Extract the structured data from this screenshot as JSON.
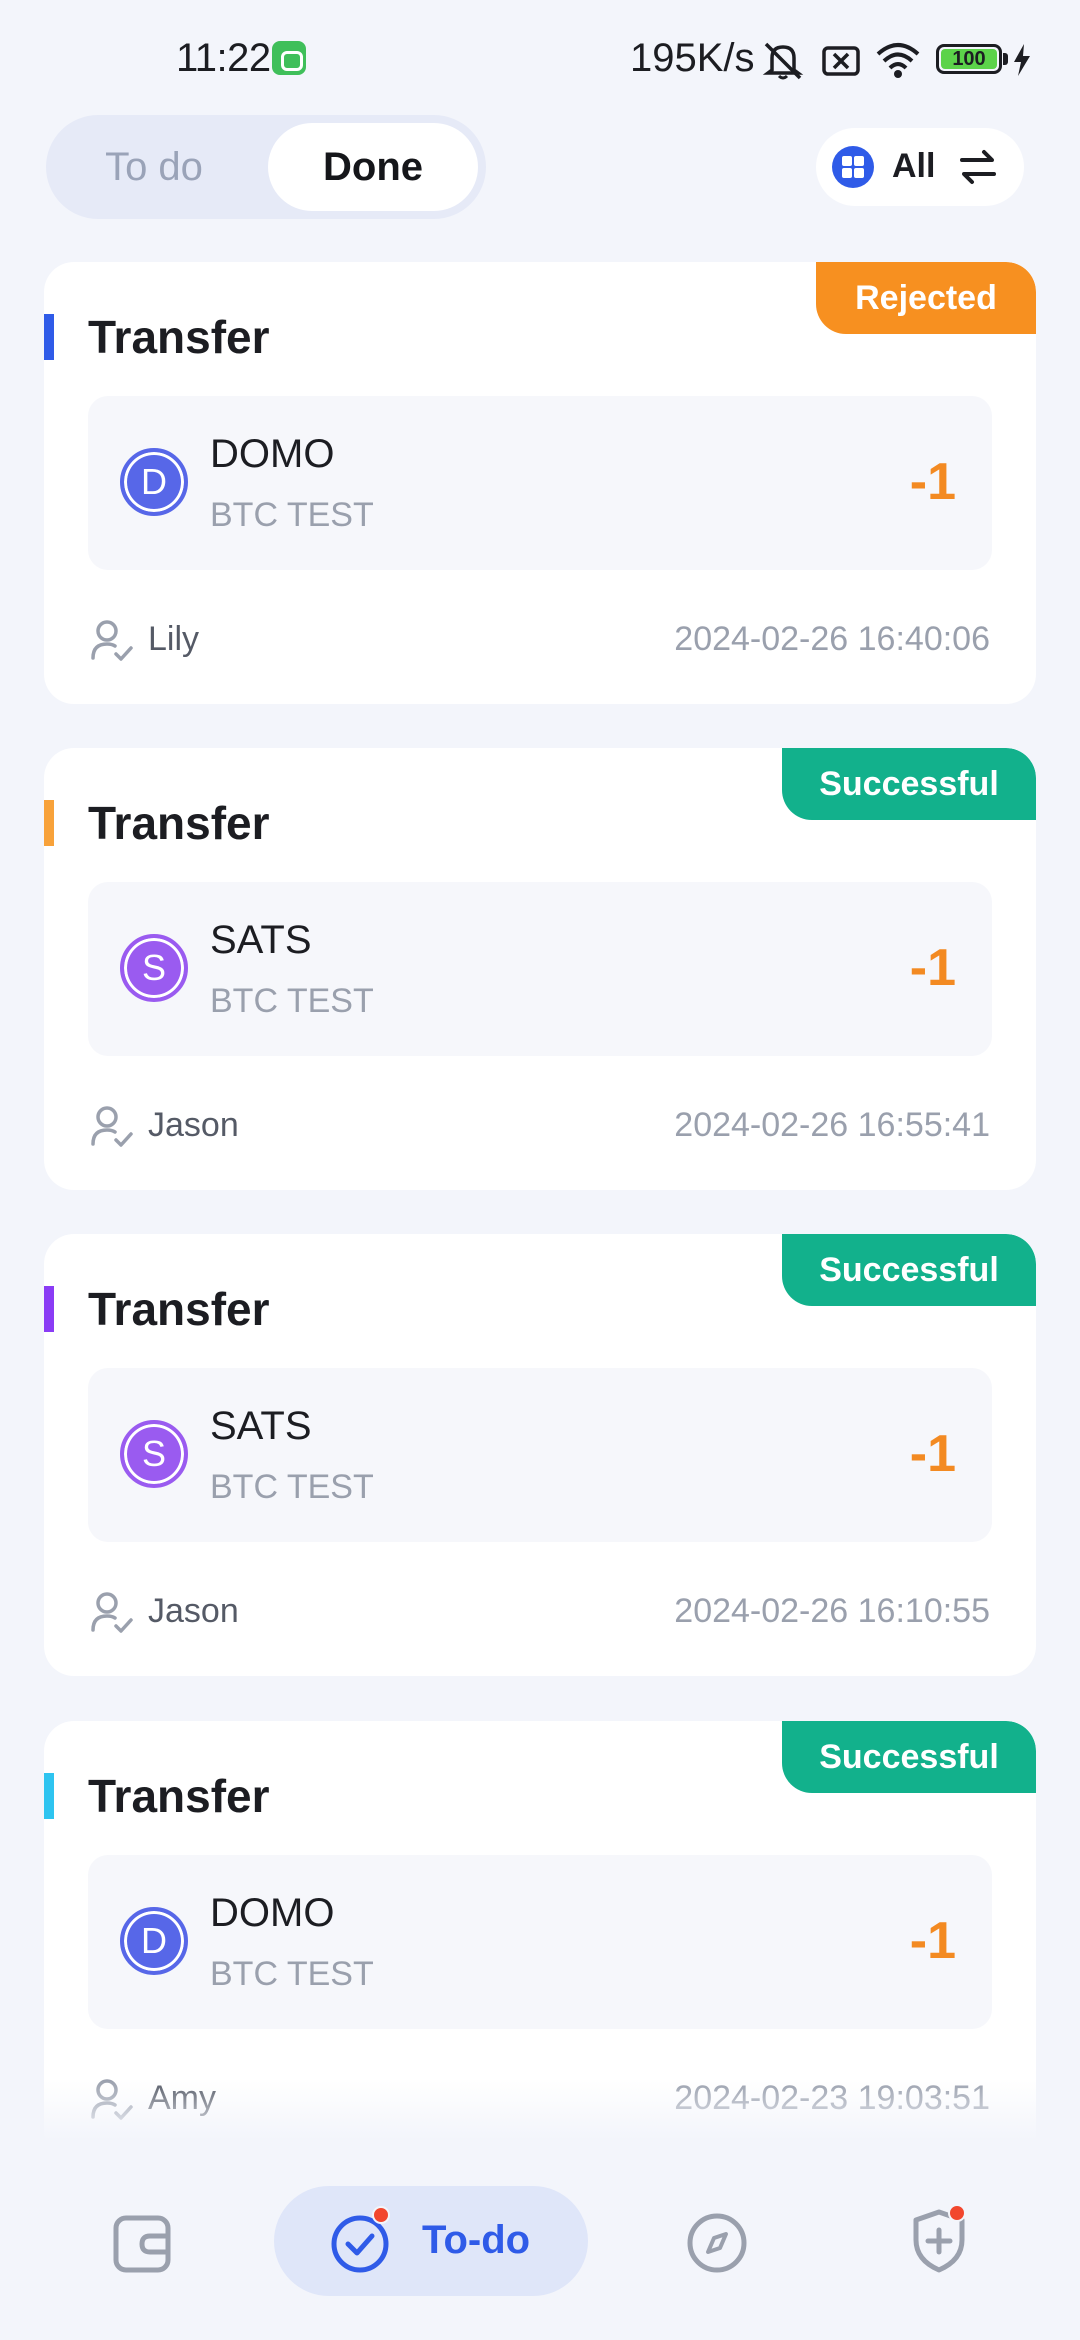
{
  "status_bar": {
    "time": "11:22",
    "network_speed": "195K/s",
    "battery": "100"
  },
  "header": {
    "tabs": [
      {
        "label": "To do",
        "active": false
      },
      {
        "label": "Done",
        "active": true
      }
    ],
    "filter": {
      "label": "All",
      "icon": "grid-icon",
      "swap_icon": "swap-icon"
    }
  },
  "cards": [
    {
      "title": "Transfer",
      "accent_color": "#2f5be8",
      "status": "Rejected",
      "status_color": "#f79020",
      "asset": {
        "initial": "D",
        "name": "DOMO",
        "sub": "BTC TEST",
        "avatar_color": "#5767e8"
      },
      "amount": "-1",
      "user": "Lily",
      "time": "2024-02-26 16:40:06"
    },
    {
      "title": "Transfer",
      "accent_color": "#f8a23a",
      "status": "Successful",
      "status_color": "#12b18c",
      "asset": {
        "initial": "S",
        "name": "SATS",
        "sub": "BTC TEST",
        "avatar_color": "#9a5bf0"
      },
      "amount": "-1",
      "user": "Jason",
      "time": "2024-02-26 16:55:41"
    },
    {
      "title": "Transfer",
      "accent_color": "#8a3cf5",
      "status": "Successful",
      "status_color": "#12b18c",
      "asset": {
        "initial": "S",
        "name": "SATS",
        "sub": "BTC TEST",
        "avatar_color": "#9a5bf0"
      },
      "amount": "-1",
      "user": "Jason",
      "time": "2024-02-26 16:10:55"
    },
    {
      "title": "Transfer",
      "accent_color": "#2ec4f0",
      "status": "Successful",
      "status_color": "#12b18c",
      "asset": {
        "initial": "D",
        "name": "DOMO",
        "sub": "BTC TEST",
        "avatar_color": "#5767e8"
      },
      "amount": "-1",
      "user": "Amy",
      "time": "2024-02-23 19:03:51"
    }
  ],
  "bottom_nav": [
    {
      "icon": "wallet-icon",
      "label": ""
    },
    {
      "icon": "check-circle-icon",
      "label": "To-do",
      "active": true,
      "badge": true
    },
    {
      "icon": "compass-icon",
      "label": ""
    },
    {
      "icon": "shield-plus-icon",
      "label": "",
      "badge": true
    }
  ]
}
